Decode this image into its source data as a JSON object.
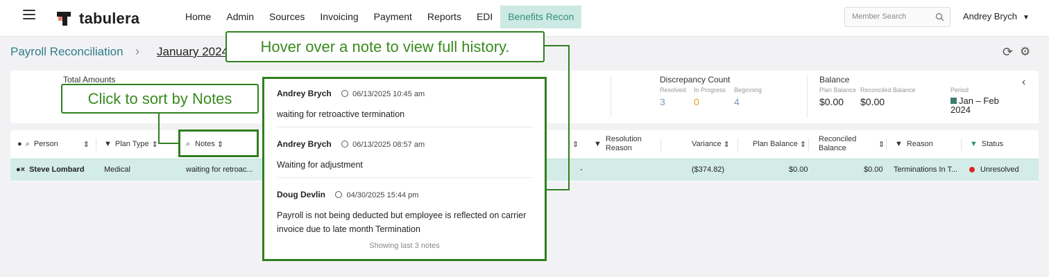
{
  "nav": {
    "logo": "tabulera",
    "menu": [
      "Home",
      "Admin",
      "Sources",
      "Invoicing",
      "Payment",
      "Reports",
      "EDI",
      "Benefits Recon"
    ],
    "search_placeholder": "Member Search",
    "user": "Andrey Brych"
  },
  "breadcrumb": {
    "root": "Payroll Reconciliation",
    "current": "January 2024"
  },
  "summary": {
    "total_amounts": "Total Amounts",
    "discrepancy": {
      "title": "Discrepancy Count",
      "resolved_label": "Resolved",
      "resolved": "3",
      "in_progress_label": "In Progress",
      "in_progress": "0",
      "beginning_label": "Beginning",
      "beginning": "4"
    },
    "balance": {
      "title": "Balance",
      "plan_label": "Plan Balance",
      "plan": "$0.00",
      "reconciled_label": "Reconciled Balance",
      "reconciled": "$0.00",
      "period_label": "Period",
      "period": "Jan – Feb 2024"
    }
  },
  "table": {
    "headers": {
      "person": "Person",
      "plan_type": "Plan Type",
      "notes": "Notes",
      "resolution_reason": "Resolution Reason",
      "variance": "Variance",
      "plan_balance": "Plan Balance",
      "reconciled_balance": "Reconciled Balance",
      "reason": "Reason",
      "status": "Status"
    },
    "row": {
      "person": "Steve Lombard",
      "plan_type": "Medical",
      "notes": "waiting for retroac...",
      "resolution_reason": "-",
      "variance": "($374.82)",
      "plan_balance": "$0.00",
      "reconciled_balance": "$0.00",
      "reason": "Terminations In T...",
      "status": "Unresolved"
    }
  },
  "callouts": {
    "sort": "Click to sort by Notes",
    "hover": "Hover over a note to view full history."
  },
  "notes_popup": {
    "notes": [
      {
        "author": "Andrey Brych",
        "time": "06/13/2025 10:45 am",
        "text": "waiting for retroactive termination"
      },
      {
        "author": "Andrey Brych",
        "time": "06/13/2025 08:57 am",
        "text": "Waiting for adjustment"
      },
      {
        "author": "Doug Devlin",
        "time": "04/30/2025 15:44 pm",
        "text": "Payroll is not being deducted but employee is reflected on carrier invoice due to late month Termination"
      }
    ],
    "footer": "Showing last 3 notes"
  },
  "colors": {
    "accent": "#2e8e7c",
    "callout_green": "#2f7f20",
    "row_highlight": "#d3ece7",
    "status_red": "#e02424"
  }
}
